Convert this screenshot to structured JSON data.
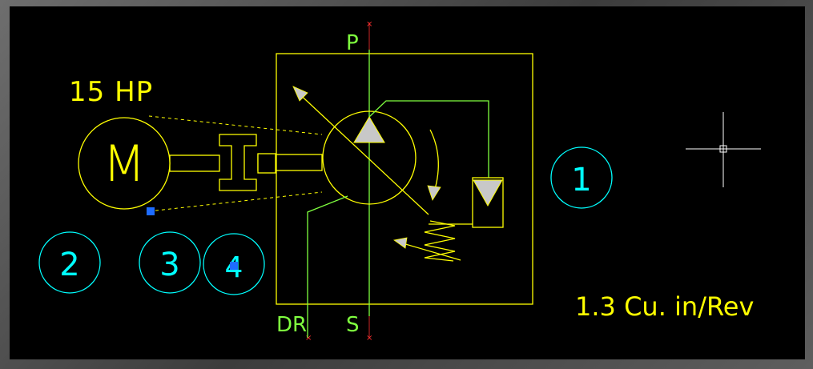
{
  "colors": {
    "yellow": "#ffff00",
    "green": "#7fff3f",
    "cyan": "#00ffff",
    "white": "#ffffff",
    "grip_blue": "#1e6cff",
    "marker_red": "#ff3030",
    "background": "#000000"
  },
  "labels": {
    "motor_power": "15 HP",
    "motor_symbol": "M",
    "port_pressure": "P",
    "port_suction": "S",
    "port_drain": "DR",
    "displacement": "1.3 Cu. in/Rev"
  },
  "balloons": [
    "1",
    "2",
    "3",
    "4"
  ],
  "icons": {
    "crosshair": "crosshair-cursor-icon",
    "grip": "selection-grip-icon"
  }
}
